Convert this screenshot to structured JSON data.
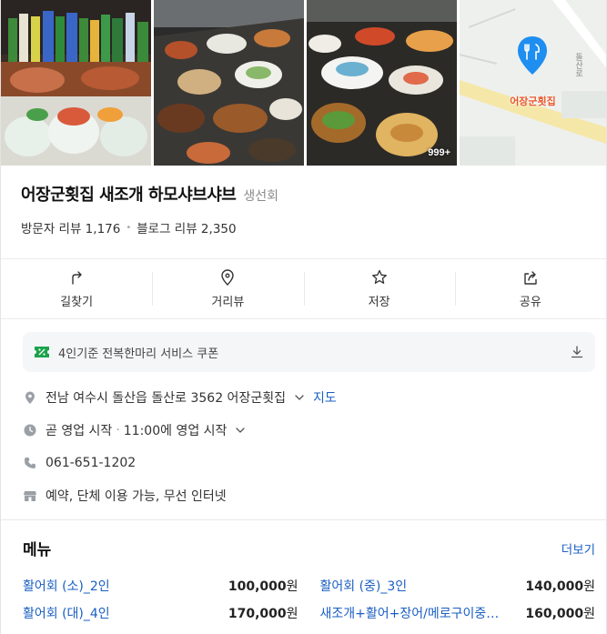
{
  "photos": {
    "more_count": "999+",
    "map_place_label": "어장군횟집",
    "map_road_label": "돌산로"
  },
  "place": {
    "name": "어장군횟집 새조개 하모샤브샤브",
    "category": "생선회",
    "visitor_reviews": "방문자 리뷰 1,176",
    "blog_reviews": "블로그 리뷰 2,350"
  },
  "actions": [
    {
      "label": "길찾기",
      "icon": "directions-icon"
    },
    {
      "label": "거리뷰",
      "icon": "location-pin-icon"
    },
    {
      "label": "저장",
      "icon": "star-icon"
    },
    {
      "label": "공유",
      "icon": "share-icon"
    }
  ],
  "coupon": {
    "text": "4인기준 전복한마리 서비스 쿠폰"
  },
  "info": {
    "address": "전남 여수시 돌산읍 돌산로 3562 어장군횟집",
    "map_link": "지도",
    "hours_status": "곧 영업 시작",
    "hours_detail": "11:00에 영업 시작",
    "phone": "061-651-1202",
    "amenities": "예약, 단체 이용 가능, 무선 인터넷"
  },
  "menu": {
    "title": "메뉴",
    "more": "더보기",
    "items": [
      {
        "name": "활어회 (소)_2인",
        "price": "100,000",
        "unit": "원"
      },
      {
        "name": "활어회 (중)_3인",
        "price": "140,000",
        "unit": "원"
      },
      {
        "name": "활어회 (대)_4인",
        "price": "170,000",
        "unit": "원"
      },
      {
        "name": "새조개+활어+장어/메로구이중 ...",
        "price": "160,000",
        "unit": "원"
      }
    ]
  },
  "colors": {
    "link": "#1a5fc2",
    "map_pin": "#1e8ef0",
    "coupon_green": "#1aa34a"
  }
}
